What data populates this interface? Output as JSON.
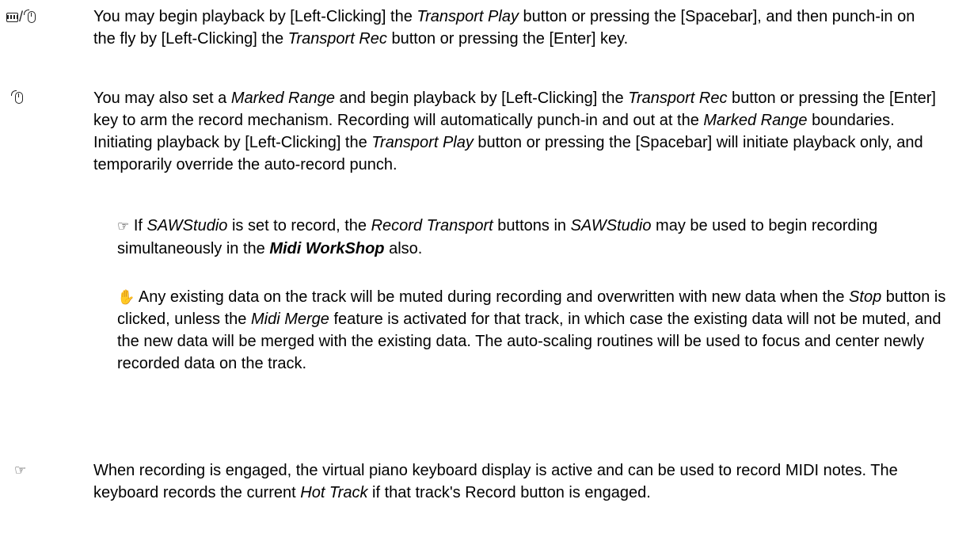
{
  "icons": {
    "p1": "keyboard-mouse-icon",
    "p2": "mouse-icon",
    "n1": "pointing-hand-icon",
    "n2": "hand-icon",
    "p3": "pointing-hand-icon"
  },
  "glyphs": {
    "pointer": "☞",
    "hand": "✋",
    "slash": "/"
  },
  "p1": {
    "a": "You may begin playback by [Left-Clicking] the ",
    "b": "Transport Play",
    "c": " button or pressing the [Spacebar], and then punch-in on the fly by [Left-Clicking] the ",
    "d": "Transport Rec",
    "e": " button or pressing the [Enter] key."
  },
  "p2": {
    "a": "You may also set a ",
    "b": "Marked Range",
    "c": " and begin playback by [Left-Clicking] the ",
    "d": "Transport Rec",
    "e": " button or pressing the [Enter] key to arm the record mechanism. Recording will automatically punch-in and out at the ",
    "f": "Marked Range",
    "g": " boundaries. Initiating playback by [Left-Clicking] the ",
    "h": "Transport Play",
    "i": " button or pressing the [Spacebar] will initiate playback only, and temporarily override the auto-record punch."
  },
  "n1": {
    "a": "If ",
    "b": "SAWStudio",
    "c": " is set to record, the ",
    "d": "Record Transport",
    "e": " buttons in ",
    "f": "SAWStudio",
    "g": " may be used to begin recording simultaneously in the ",
    "h": "Midi WorkShop",
    "i": " also."
  },
  "n2": {
    "a": "Any existing data on the track will be muted during recording and overwritten with new data when the ",
    "b": "Stop",
    "c": " button is clicked, unless the ",
    "d": "Midi Merge",
    "e": " feature is activated for that track, in which case the existing data will not be muted, and the new data will be merged with the existing data. The auto-scaling routines will be used to focus and center newly recorded data on the track."
  },
  "p3": {
    "a": "When recording is engaged, the virtual piano keyboard display is active and can be used to record MIDI notes. The keyboard records the current ",
    "b": "Hot Track",
    "c": " if that track's Record button is engaged."
  }
}
